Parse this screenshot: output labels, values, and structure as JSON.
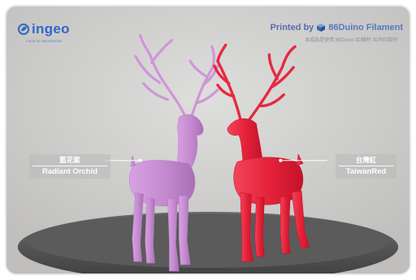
{
  "logo": {
    "text": "ingeo",
    "tagline": "made by NatureWorks"
  },
  "credit": {
    "prefix": "Printed by",
    "brand": "86Duino Filament",
    "subtitle": "本成品是使用 86Duino 3D線材 3D列印製作"
  },
  "labels": {
    "left": {
      "chinese": "藍花紫",
      "english": "Radiant Orchid"
    },
    "right": {
      "chinese": "台灣紅",
      "english": "TaiwanRed"
    }
  },
  "colors": {
    "orchid": "#c78dd1",
    "taiwan_red": "#e8283d",
    "brand_blue": "#2f68c9"
  }
}
